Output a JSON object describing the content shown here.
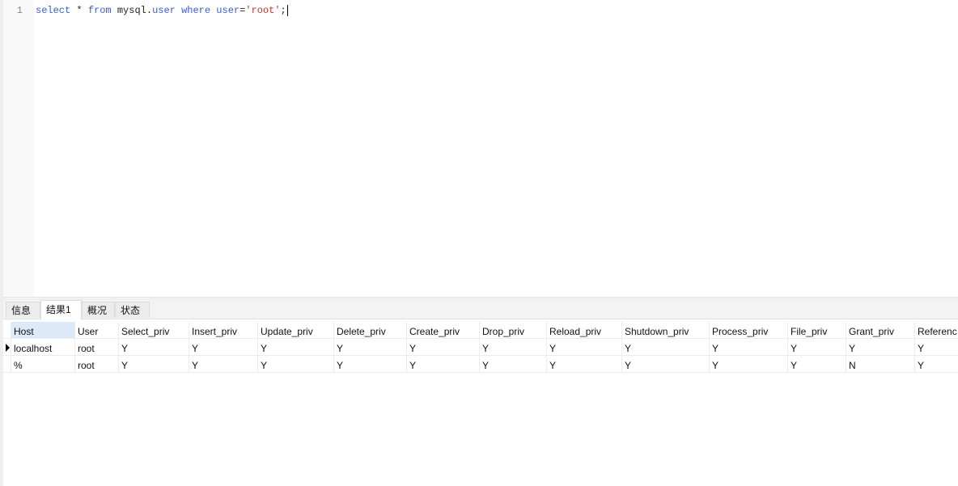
{
  "editor": {
    "line_number": "1",
    "tokens": {
      "t1": "select",
      "t2": " * ",
      "t3": "from",
      "t4": " mysql.",
      "t5": "user",
      "t6": " ",
      "t7": "where",
      "t8": " ",
      "t9": "user",
      "t10": "=",
      "t11": "'root'",
      "t12": ";"
    }
  },
  "tabs": [
    {
      "label": "信息",
      "active": false
    },
    {
      "label": "结果1",
      "active": true
    },
    {
      "label": "概况",
      "active": false
    },
    {
      "label": "状态",
      "active": false
    }
  ],
  "result": {
    "columns": [
      "Host",
      "User",
      "Select_priv",
      "Insert_priv",
      "Update_priv",
      "Delete_priv",
      "Create_priv",
      "Drop_priv",
      "Reload_priv",
      "Shutdown_priv",
      "Process_priv",
      "File_priv",
      "Grant_priv",
      "Referenc"
    ],
    "rows": [
      [
        "localhost",
        "root",
        "Y",
        "Y",
        "Y",
        "Y",
        "Y",
        "Y",
        "Y",
        "Y",
        "Y",
        "Y",
        "Y",
        "Y"
      ],
      [
        "%",
        "root",
        "Y",
        "Y",
        "Y",
        "Y",
        "Y",
        "Y",
        "Y",
        "Y",
        "Y",
        "Y",
        "N",
        "Y"
      ]
    ],
    "selected_row": 0,
    "selected_column": "Host"
  }
}
